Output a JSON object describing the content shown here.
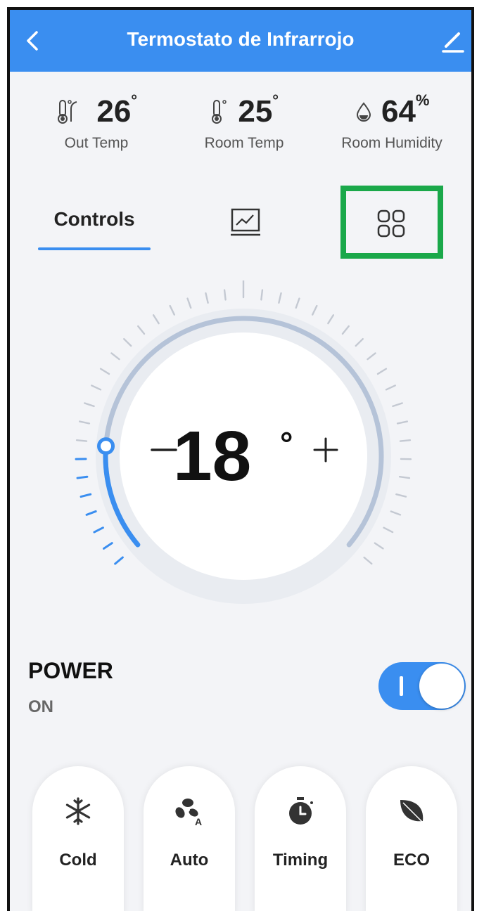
{
  "header": {
    "title": "Termostato de Infrarrojo"
  },
  "stats": [
    {
      "value": "26",
      "unit": "°",
      "label": "Out Temp"
    },
    {
      "value": "25",
      "unit": "°",
      "label": "Room Temp"
    },
    {
      "value": "64",
      "unit": "%",
      "label": "Room Humidity"
    }
  ],
  "tabs": {
    "controls_label": "Controls"
  },
  "dial": {
    "setpoint": "18",
    "unit": "°",
    "level_fraction": 0.17
  },
  "power": {
    "label": "POWER",
    "state": "ON",
    "toggle_on": true
  },
  "modes": [
    {
      "label": "Cold",
      "icon": "snowflake-icon"
    },
    {
      "label": "Auto",
      "icon": "fan-auto-icon"
    },
    {
      "label": "Timing",
      "icon": "timer-icon"
    },
    {
      "label": "ECO",
      "icon": "leaf-icon"
    }
  ],
  "colors": {
    "accent": "#3a8ef0",
    "highlight": "#1aa84a",
    "background": "#f3f4f7"
  }
}
